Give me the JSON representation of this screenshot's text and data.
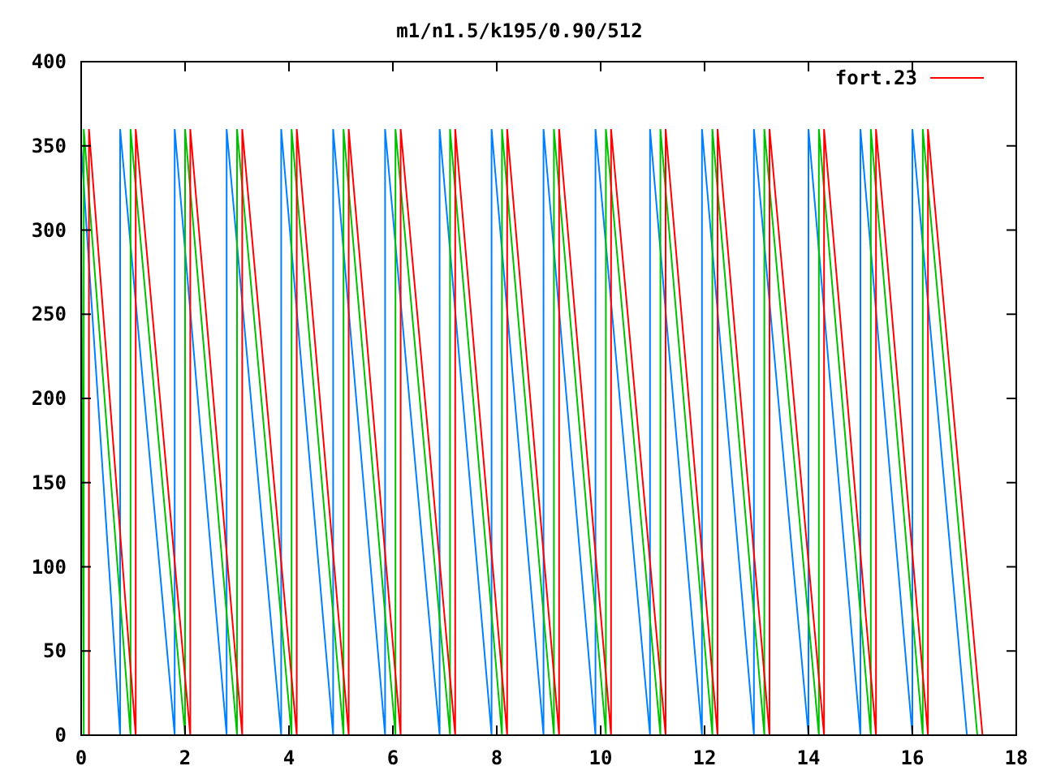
{
  "chart_data": {
    "type": "line",
    "title": "m1/n1.5/k195/0.90/512",
    "xlim": [
      0,
      18
    ],
    "ylim": [
      0,
      400
    ],
    "xticks": [
      0,
      2,
      4,
      6,
      8,
      10,
      12,
      14,
      16,
      18
    ],
    "yticks": [
      0,
      50,
      100,
      150,
      200,
      250,
      300,
      350,
      400
    ],
    "series": [
      {
        "color": "#0080ff",
        "x": [
          0,
          0.75,
          0.75,
          1.8,
          1.8,
          2.8,
          2.8,
          3.85,
          3.85,
          4.85,
          4.85,
          5.85,
          5.85,
          6.9,
          6.9,
          7.9,
          7.9,
          8.9,
          8.9,
          9.9,
          9.9,
          10.95,
          10.95,
          11.95,
          11.95,
          12.95,
          12.95,
          14.0,
          14.0,
          15.0,
          15.0,
          16.0,
          16.0,
          17.05
        ],
        "values": [
          350,
          0,
          360,
          0,
          360,
          0,
          360,
          0,
          360,
          0,
          360,
          0,
          360,
          0,
          360,
          0,
          360,
          0,
          360,
          0,
          360,
          0,
          360,
          0,
          360,
          0,
          360,
          0,
          360,
          0,
          360,
          0,
          360,
          0
        ]
      },
      {
        "color": "#00c000",
        "x": [
          0,
          0.05,
          0.05,
          0.95,
          0.95,
          2.0,
          2.0,
          3.0,
          3.0,
          4.05,
          4.05,
          5.05,
          5.05,
          6.05,
          6.05,
          7.1,
          7.1,
          8.1,
          8.1,
          9.1,
          9.1,
          10.1,
          10.1,
          11.15,
          11.15,
          12.15,
          12.15,
          13.15,
          13.15,
          14.2,
          14.2,
          15.2,
          15.2,
          16.2,
          16.2,
          17.25
        ],
        "values": [
          330,
          0,
          360,
          0,
          360,
          0,
          360,
          0,
          360,
          0,
          360,
          0,
          360,
          0,
          360,
          0,
          360,
          0,
          360,
          0,
          360,
          0,
          360,
          0,
          360,
          0,
          360,
          0,
          360,
          0,
          360,
          0,
          360,
          0,
          360,
          0
        ]
      },
      {
        "name": "fort.23",
        "color": "#ff0000",
        "x": [
          0.15,
          0.15,
          1.05,
          1.05,
          2.1,
          2.1,
          3.1,
          3.1,
          4.15,
          4.15,
          5.15,
          5.15,
          6.15,
          6.15,
          7.2,
          7.2,
          8.2,
          8.2,
          9.2,
          9.2,
          10.2,
          10.2,
          11.25,
          11.25,
          12.25,
          12.25,
          13.25,
          13.25,
          14.3,
          14.3,
          15.3,
          15.3,
          16.3,
          16.3,
          17.35
        ],
        "values": [
          0,
          360,
          0,
          360,
          0,
          360,
          0,
          360,
          0,
          360,
          0,
          360,
          0,
          360,
          0,
          360,
          0,
          360,
          0,
          360,
          0,
          360,
          0,
          360,
          0,
          360,
          0,
          360,
          0,
          360,
          0,
          360,
          0,
          360,
          0
        ]
      }
    ]
  }
}
